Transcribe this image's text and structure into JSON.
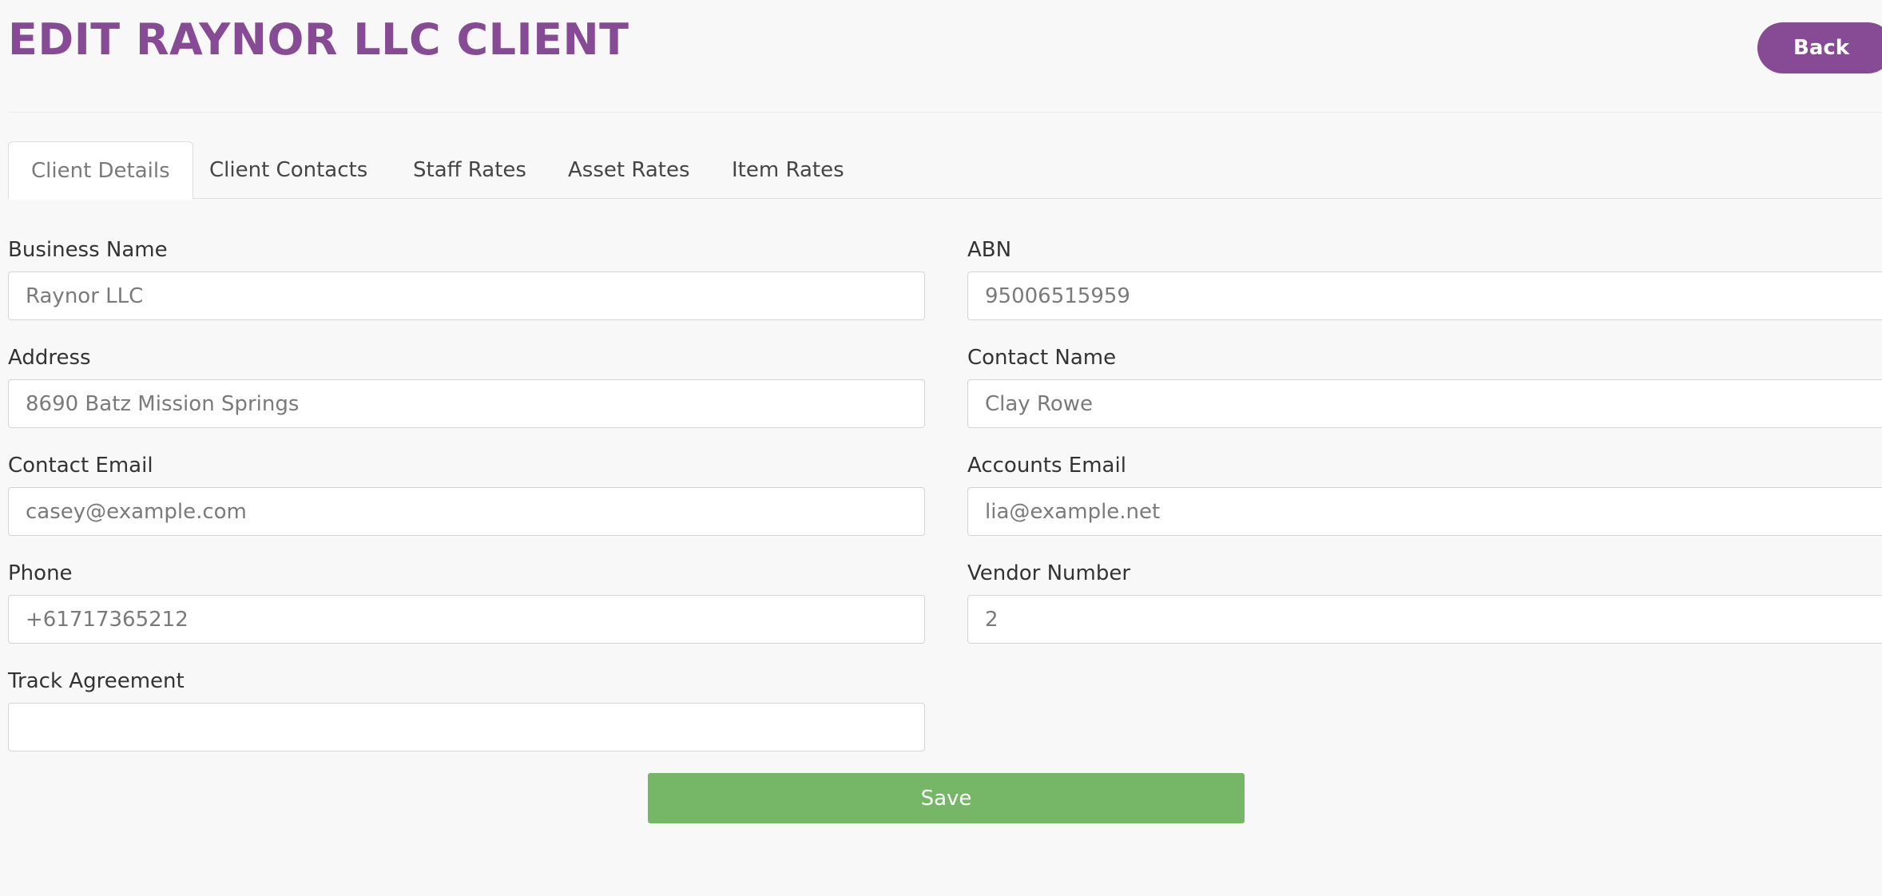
{
  "header": {
    "title": "EDIT RAYNOR LLC CLIENT",
    "back_label": "Back"
  },
  "tabs": [
    {
      "label": "Client Details",
      "active": true
    },
    {
      "label": "Client Contacts",
      "active": false
    },
    {
      "label": "Staff Rates",
      "active": false
    },
    {
      "label": "Asset Rates",
      "active": false
    },
    {
      "label": "Item Rates",
      "active": false
    }
  ],
  "form": {
    "business_name": {
      "label": "Business Name",
      "value": "Raynor LLC"
    },
    "abn": {
      "label": "ABN",
      "value": "95006515959"
    },
    "address": {
      "label": "Address",
      "value": "8690 Batz Mission Springs"
    },
    "contact_name": {
      "label": "Contact Name",
      "value": "Clay Rowe"
    },
    "contact_email": {
      "label": "Contact Email",
      "value": "casey@example.com"
    },
    "accounts_email": {
      "label": "Accounts Email",
      "value": "lia@example.net"
    },
    "phone": {
      "label": "Phone",
      "value": "+61717365212"
    },
    "vendor_number": {
      "label": "Vendor Number",
      "value": "2"
    },
    "track_agreement": {
      "label": "Track Agreement",
      "value": ""
    },
    "save_label": "Save"
  },
  "colors": {
    "accent": "#874a94",
    "save": "#76b767",
    "background": "#f8f8f8"
  }
}
